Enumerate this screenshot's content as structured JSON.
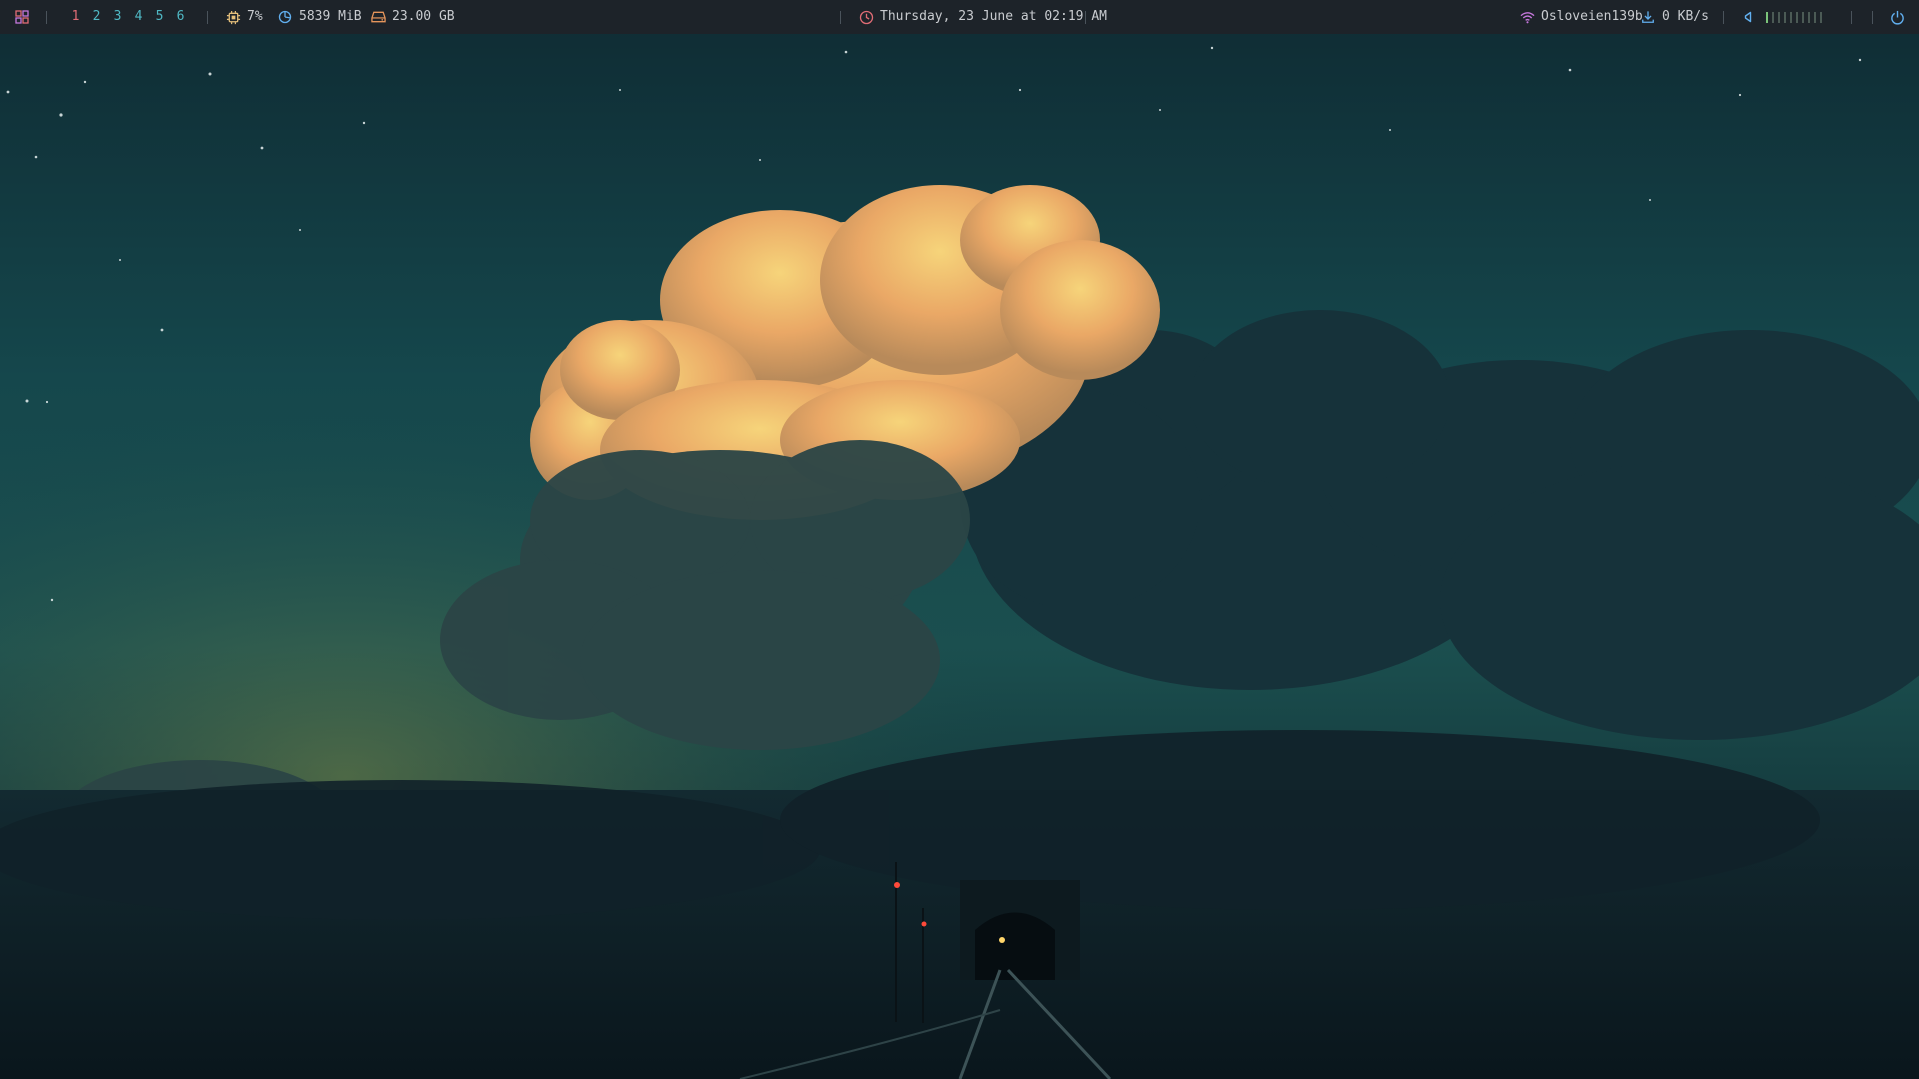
{
  "bar": {
    "launcher_icon": "grid-apps-icon",
    "workspaces": [
      {
        "label": "1",
        "active": true
      },
      {
        "label": "2",
        "active": false
      },
      {
        "label": "3",
        "active": false
      },
      {
        "label": "4",
        "active": false
      },
      {
        "label": "5",
        "active": false
      },
      {
        "label": "6",
        "active": false
      }
    ],
    "cpu": {
      "icon": "cpu-icon",
      "value": "7%"
    },
    "memory": {
      "icon": "memory-pie-icon",
      "value": "5839 MiB"
    },
    "disk": {
      "icon": "disk-drive-icon",
      "value": "23.00 GB"
    },
    "clock": {
      "icon": "clock-icon",
      "text": "Thursday, 23 June at 02:19 AM"
    },
    "network": {
      "icon": "wifi-icon",
      "ssid": "Osloveien139b"
    },
    "download": {
      "icon": "download-icon",
      "rate": "0 KB/s"
    },
    "volume": {
      "icon": "speaker-icon",
      "level_fraction": 0.1,
      "segments": 10
    },
    "power_icon": "power-icon"
  },
  "colors": {
    "bar_bg": "#1d2329",
    "workspace_active": "#e06c75",
    "workspace_inactive": "#4fb8c4",
    "cpu_icon": "#e5c07b",
    "memory_icon": "#61afef",
    "disk_icon": "#e5955b",
    "clock_icon": "#e06c75",
    "wifi_icon": "#c678dd",
    "download_icon": "#61afef",
    "volume_icon": "#61afef",
    "volume_on": "#7bc47a",
    "power_icon": "#61afef"
  },
  "wallpaper": {
    "description": "night-sky-clouds-railway-tunnel"
  }
}
